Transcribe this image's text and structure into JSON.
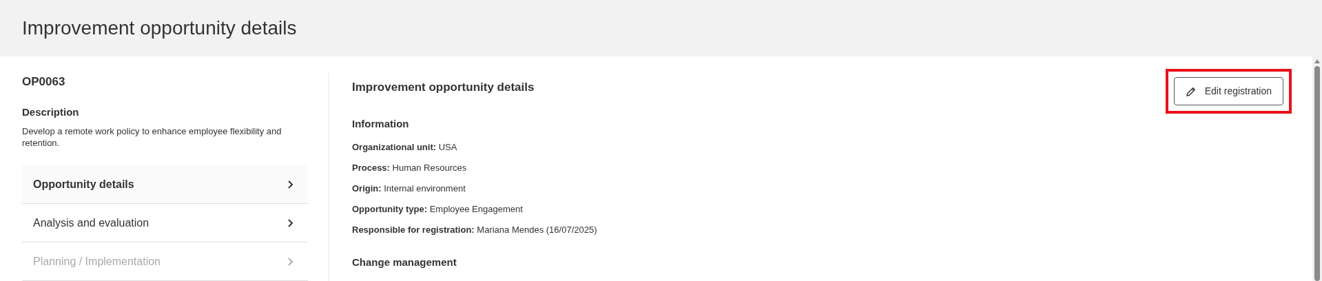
{
  "page_title": "Improvement opportunity details",
  "record": {
    "code": "OP0063",
    "description_label": "Description",
    "description": "Develop a remote work policy to enhance employee flexibility and retention."
  },
  "nav": [
    {
      "label": "Opportunity details",
      "selected": true,
      "disabled": false
    },
    {
      "label": "Analysis and evaluation",
      "selected": false,
      "disabled": false
    },
    {
      "label": "Planning / Implementation",
      "selected": false,
      "disabled": true
    }
  ],
  "details": {
    "title": "Improvement opportunity details",
    "edit_button": {
      "label": "Edit registration",
      "highlighted": true
    },
    "sections": [
      {
        "heading": "Information",
        "fields": [
          {
            "label": "Organizational unit:",
            "value": "USA"
          },
          {
            "label": "Process:",
            "value": "Human Resources"
          },
          {
            "label": "Origin:",
            "value": "Internal environment"
          },
          {
            "label": "Opportunity type:",
            "value": "Employee Engagement"
          },
          {
            "label": "Responsible for registration:",
            "value": "Mariana Mendes (16/07/2025)"
          }
        ]
      },
      {
        "heading": "Change management"
      }
    ]
  }
}
